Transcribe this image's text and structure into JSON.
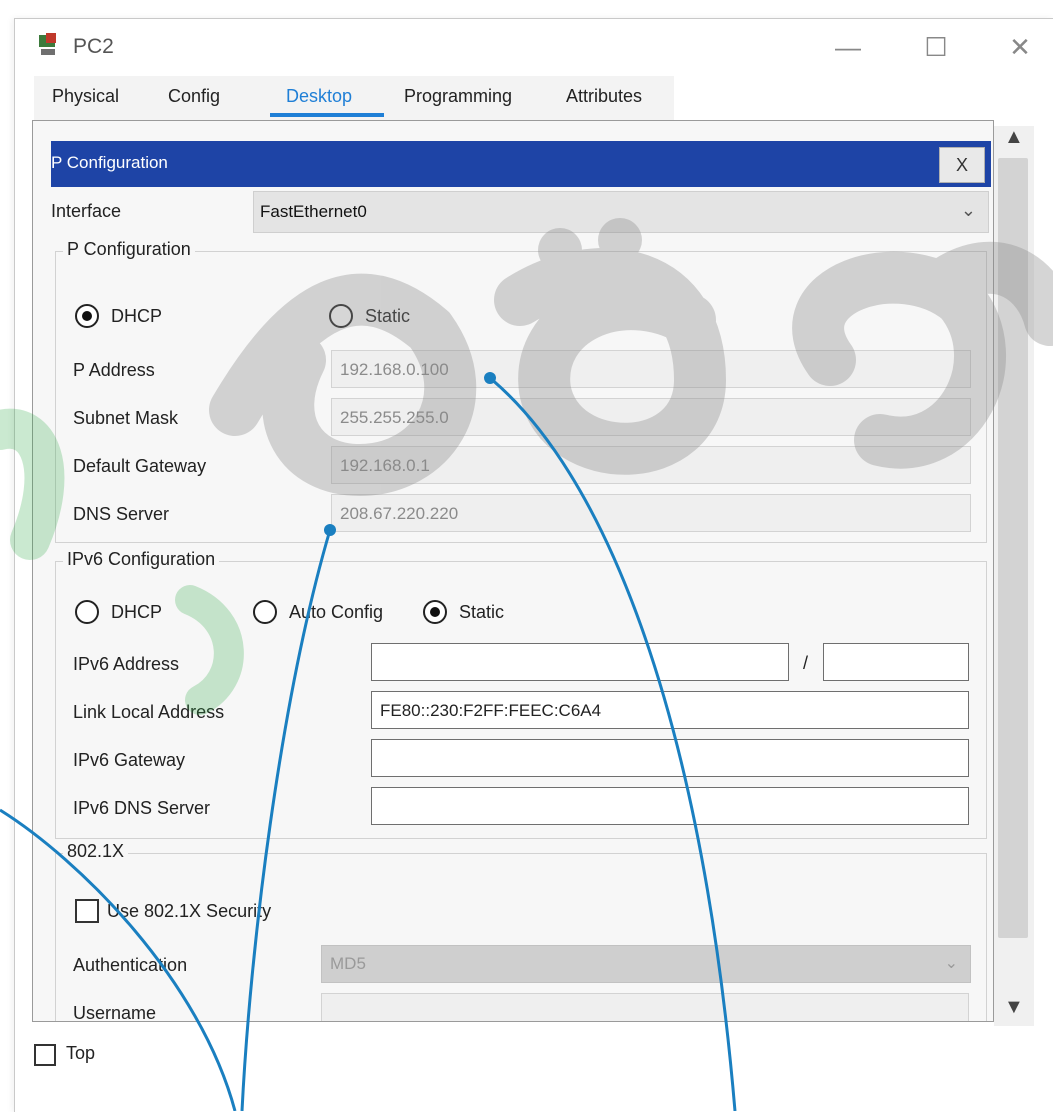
{
  "window": {
    "title": "PC2",
    "minimize_glyph": "—",
    "maximize_glyph": "☐",
    "close_glyph": "✕"
  },
  "tabs": [
    "Physical",
    "Config",
    "Desktop",
    "Programming",
    "Attributes"
  ],
  "active_tab": "Desktop",
  "panel": {
    "title": "P Configuration",
    "close_label": "X",
    "interface_label": "Interface",
    "interface_value": "FastEthernet0"
  },
  "ipv4": {
    "legend": "P Configuration",
    "dhcp_label": "DHCP",
    "static_label": "Static",
    "selected": "DHCP",
    "ip_label": "P Address",
    "ip_value": "192.168.0.100",
    "mask_label": "Subnet Mask",
    "mask_value": "255.255.255.0",
    "gateway_label": "Default Gateway",
    "gateway_value": "192.168.0.1",
    "dns_label": "DNS Server",
    "dns_value": "208.67.220.220"
  },
  "ipv6": {
    "legend": "IPv6 Configuration",
    "dhcp_label": "DHCP",
    "auto_label": "Auto Config",
    "static_label": "Static",
    "selected": "Static",
    "address_label": "IPv6 Address",
    "address_value": "",
    "prefix_separator": "/",
    "prefix_value": "",
    "link_local_label": "Link Local Address",
    "link_local_value": "FE80::230:F2FF:FEEC:C6A4",
    "gateway_label": "IPv6 Gateway",
    "gateway_value": "",
    "dns_label": "IPv6 DNS Server",
    "dns_value": ""
  },
  "dot1x": {
    "legend": "802.1X",
    "use_security_label": "Use 802.1X Security",
    "authentication_label": "Authentication",
    "authentication_value": "MD5",
    "username_label": "Username",
    "username_value": ""
  },
  "bottom": {
    "top_label": "Top"
  },
  "icons": {
    "app": "pc-icon",
    "scroll_up": "▲",
    "scroll_down": "▼",
    "dropdown": "⌄"
  },
  "colors": {
    "titlebar_blue": "#1e44a6",
    "active_tab": "#1f7fd6",
    "annotation_line": "#1a7fc0",
    "watermark": "#8a8a8a",
    "watermark_green": "#2aa845"
  }
}
